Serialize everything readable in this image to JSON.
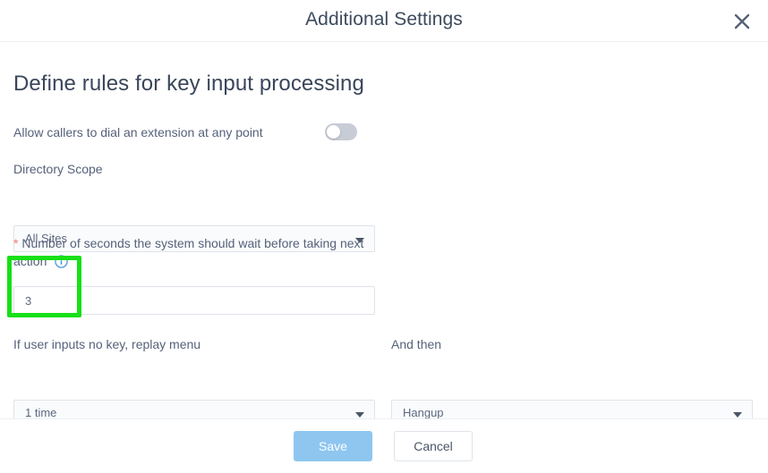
{
  "modal": {
    "title": "Additional Settings",
    "close_icon": "close-icon"
  },
  "content": {
    "heading": "Define rules for key input processing",
    "toggle": {
      "label": "Allow callers to dial an extension at any point",
      "state": "off"
    },
    "directory_scope": {
      "label": "Directory Scope",
      "value": "All Sites"
    },
    "wait_seconds": {
      "label_required_marker": "*",
      "label": "Number of seconds the system should wait before taking next action",
      "label_line1": "Number of seconds the system should wait before taking next",
      "label_line2": "action",
      "info_icon": "info-icon",
      "value": "3"
    },
    "replay_menu": {
      "label": "If user inputs no key, replay menu",
      "value": "1 time"
    },
    "and_then": {
      "label": "And then",
      "value": "Hangup"
    }
  },
  "footer": {
    "save_label": "Save",
    "cancel_label": "Cancel"
  },
  "colors": {
    "accent_blue": "#8ec6f0",
    "text_primary": "#39465a",
    "text_secondary": "#55617a",
    "required_star": "#f07a6e",
    "toggle_track_off": "#c7ccd6",
    "annotation_green": "#16e016",
    "border": "#dfe3ea",
    "field_bg": "#fafbfc"
  }
}
